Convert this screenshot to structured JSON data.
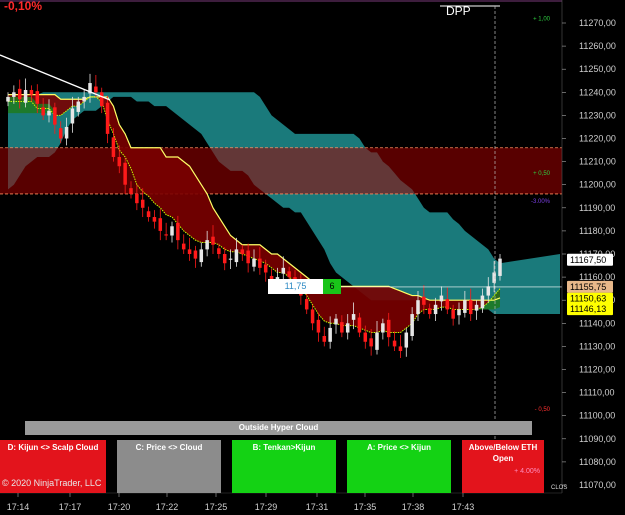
{
  "header": {
    "change_percent": "-0,10%",
    "dpp_label": "DPP"
  },
  "chart_data": {
    "type": "candlestick",
    "title": "",
    "ylim": [
      11065,
      11280
    ],
    "y_ticks": [
      11070,
      11080,
      11090,
      11100,
      11110,
      11120,
      11130,
      11140,
      11150,
      11160,
      11170,
      11180,
      11190,
      11200,
      11210,
      11220,
      11230,
      11240,
      11250,
      11260,
      11270
    ],
    "y_tick_labels": [
      "11070,00",
      "11080,00",
      "11090,00",
      "11100,00",
      "11110,00",
      "11120,00",
      "11130,00",
      "11140,00",
      "11150,00",
      "11160,00",
      "11170,00",
      "11180,00",
      "11190,00",
      "11200,00",
      "11210,00",
      "11220,00",
      "11230,00",
      "11240,00",
      "11250,00",
      "11260,00",
      "11270,00"
    ],
    "x_tick_labels": [
      "17:14",
      "17:17",
      "17:20",
      "17:22",
      "17:25",
      "17:29",
      "17:31",
      "17:35",
      "17:38",
      "17:43"
    ],
    "closes": [
      11238,
      11240,
      11237,
      11241,
      11239,
      11235,
      11230,
      11232,
      11226,
      11220,
      11225,
      11233,
      11236,
      11238,
      11244,
      11240,
      11234,
      11222,
      11212,
      11208,
      11200,
      11196,
      11192,
      11190,
      11186,
      11184,
      11180,
      11178,
      11182,
      11176,
      11172,
      11170,
      11168,
      11172,
      11176,
      11174,
      11170,
      11166,
      11168,
      11172,
      11170,
      11166,
      11168,
      11164,
      11162,
      11158,
      11160,
      11164,
      11160,
      11156,
      11152,
      11146,
      11140,
      11136,
      11132,
      11138,
      11142,
      11136,
      11140,
      11144,
      11136,
      11132,
      11130,
      11136,
      11140,
      11134,
      11130,
      11128,
      11136,
      11144,
      11150,
      11148,
      11144,
      11148,
      11152,
      11146,
      11142,
      11146,
      11150,
      11144,
      11148,
      11152,
      11156,
      11162,
      11168
    ],
    "tenkan": [
      11236,
      11236,
      11236,
      11236,
      11236,
      11233,
      11233,
      11233,
      11230,
      11230,
      11232,
      11234,
      11234,
      11236,
      11238,
      11238,
      11236,
      11228,
      11222,
      11215,
      11212,
      11207,
      11200,
      11197,
      11195,
      11192,
      11190,
      11187,
      11186,
      11183,
      11180,
      11178,
      11176,
      11175,
      11175,
      11175,
      11174,
      11172,
      11171,
      11171,
      11170,
      11169,
      11168,
      11167,
      11166,
      11164,
      11162,
      11162,
      11160,
      11158,
      11156,
      11152,
      11148,
      11144,
      11141,
      11140,
      11140,
      11139,
      11139,
      11139,
      11138,
      11137,
      11136,
      11136,
      11137,
      11136,
      11136,
      11136,
      11138,
      11140,
      11144,
      11146,
      11146,
      11146,
      11147,
      11147,
      11146,
      11146,
      11146,
      11146,
      11146,
      11147,
      11149,
      11152,
      11155
    ],
    "kijun": [
      11239,
      11239,
      11239,
      11239,
      11239,
      11239,
      11239,
      11239,
      11239,
      11237,
      11237,
      11237,
      11237,
      11237,
      11238,
      11238,
      11238,
      11238,
      11234,
      11226,
      11222,
      11216,
      11216,
      11216,
      11216,
      11216,
      11216,
      11212,
      11212,
      11212,
      11210,
      11208,
      11204,
      11200,
      11196,
      11190,
      11186,
      11182,
      11178,
      11176,
      11174,
      11174,
      11174,
      11174,
      11172,
      11170,
      11170,
      11168,
      11166,
      11164,
      11162,
      11160,
      11158,
      11156,
      11156,
      11156,
      11156,
      11156,
      11156,
      11156,
      11156,
      11156,
      11156,
      11156,
      11156,
      11156,
      11155,
      11154,
      11153,
      11152,
      11152,
      11151,
      11150,
      11150,
      11150,
      11150,
      11150,
      11150,
      11150,
      11150,
      11150,
      11150,
      11150,
      11150,
      11151
    ],
    "cloud_top": [
      11238,
      11238,
      11238,
      11238,
      11238,
      11239,
      11240,
      11240,
      11240,
      11240,
      11240,
      11240,
      11240,
      11240,
      11240,
      11240,
      11240,
      11240,
      11240,
      11240,
      11240,
      11240,
      11240,
      11240,
      11240,
      11240,
      11240,
      11240,
      11240,
      11240,
      11240,
      11240,
      11240,
      11240,
      11240,
      11240,
      11240,
      11240,
      11240,
      11240,
      11240,
      11240,
      11240,
      11238,
      11234,
      11230,
      11228,
      11226,
      11224,
      11222,
      11222,
      11222,
      11222,
      11222,
      11222,
      11222,
      11222,
      11222,
      11222,
      11222,
      11220,
      11216,
      11214,
      11214,
      11210,
      11208,
      11205,
      11202,
      11200,
      11198,
      11194,
      11190,
      11188,
      11188,
      11188,
      11188,
      11185,
      11183,
      11180,
      11178,
      11176,
      11174,
      11172,
      11168,
      11166
    ],
    "cloud_bottom": [
      11198,
      11200,
      11204,
      11208,
      11210,
      11212,
      11212,
      11212,
      11214,
      11218,
      11224,
      11228,
      11230,
      11232,
      11232,
      11232,
      11234,
      11236,
      11238,
      11238,
      11238,
      11238,
      11236,
      11236,
      11236,
      11234,
      11234,
      11234,
      11232,
      11230,
      11228,
      11226,
      11224,
      11222,
      11218,
      11214,
      11210,
      11208,
      11206,
      11206,
      11206,
      11204,
      11200,
      11198,
      11196,
      11194,
      11192,
      11190,
      11190,
      11188,
      11188,
      11184,
      11180,
      11176,
      11172,
      11166,
      11162,
      11160,
      11158,
      11156,
      11154,
      11152,
      11150,
      11150,
      11150,
      11150,
      11150,
      11150,
      11150,
      11150,
      11150,
      11150,
      11150,
      11150,
      11150,
      11150,
      11150,
      11150,
      11150,
      11150,
      11150,
      11146,
      11146,
      11144,
      11144
    ],
    "zones": [
      {
        "label": "+ 1,00",
        "value": 11272,
        "color": "#2ecc40"
      },
      {
        "label": "+ 0,50",
        "value": 11205,
        "color": "#2ecc40"
      },
      {
        "label": "-3.00%",
        "value": 11193,
        "color": "#7b3fe4"
      },
      {
        "label": "- 0,50",
        "value": 11103,
        "color": "#ff3030"
      }
    ],
    "price_tags": [
      {
        "label": "11167,50",
        "value": 11167.5,
        "bg": "#ffffff",
        "fg": "#000000"
      },
      {
        "label": "11155,75",
        "value": 11155.75,
        "bg": "#e8b88a",
        "fg": "#000000"
      },
      {
        "label": "11150,63",
        "value": 11150.63,
        "bg": "#ffff00",
        "fg": "#000000"
      },
      {
        "label": "11146,13",
        "value": 11146.13,
        "bg": "#ffff00",
        "fg": "#000000"
      }
    ],
    "colors": {
      "cloud": "#1f8f90",
      "cloud_dark": "#145e62",
      "bear_fill": "#7a0000",
      "bull_fill": "#1f7a1f",
      "tenkan": "#c8ff00",
      "kijun": "#ffff66",
      "up_candle": "#e6e6e6",
      "down_candle": "#ff1a1a",
      "zone_band": "#a00000",
      "zone_line": "#ff8a5c"
    }
  },
  "tags": {
    "value_label": "11,75",
    "count_label": "6"
  },
  "cloud_bar": {
    "label": "Outside Hyper Cloud"
  },
  "signals": [
    {
      "label": "D: Kijun <> Scalp Cloud",
      "sub": "",
      "style": "sig-red"
    },
    {
      "label": "C: Price <> Cloud",
      "sub": "",
      "style": "sig-gray"
    },
    {
      "label": "B: Tenkan>Kijun",
      "sub": "",
      "style": "sig-green"
    },
    {
      "label": "A: Price <> Kijun",
      "sub": "",
      "style": "sig-green"
    },
    {
      "label": "Above/Below ETH Open",
      "sub": "+ 4.00%",
      "style": "sig-red"
    }
  ],
  "footer": {
    "copyright": "© 2020 NinjaTrader, LLC",
    "clos_label": "CLOS"
  }
}
